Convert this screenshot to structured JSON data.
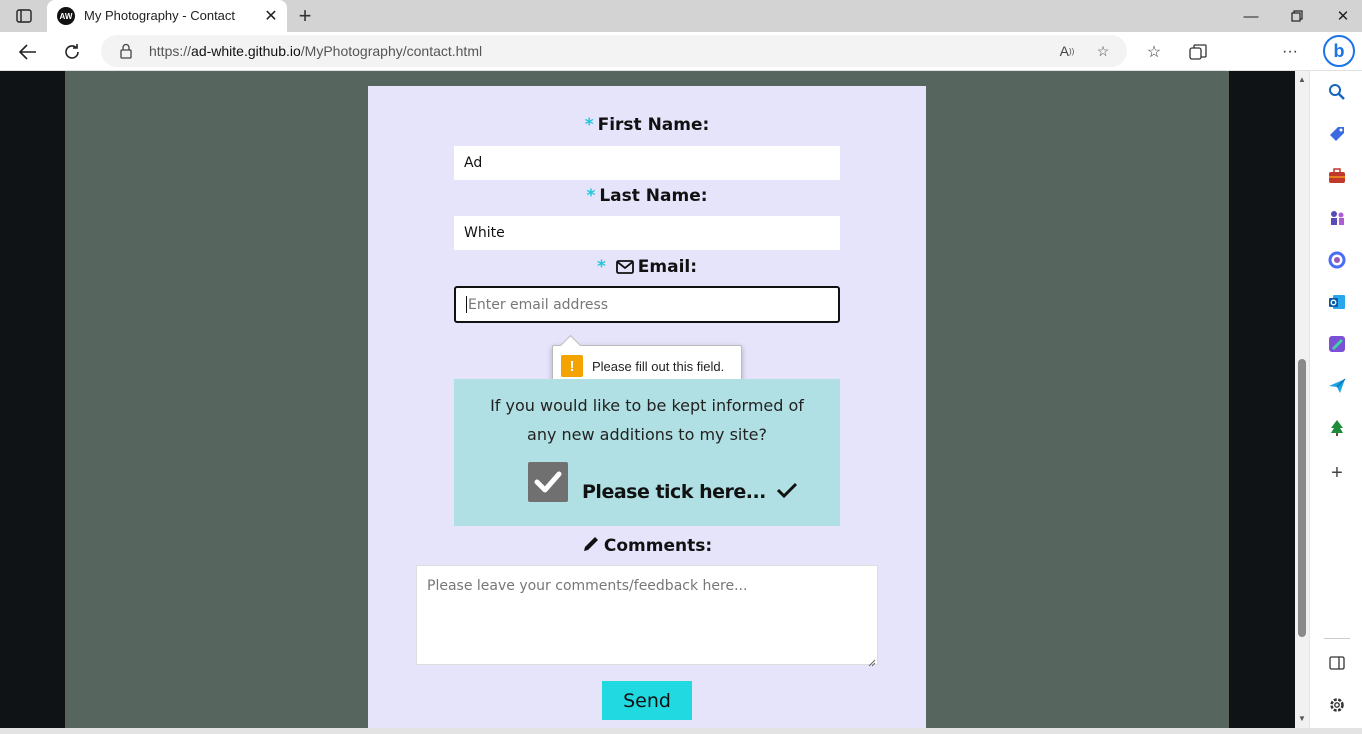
{
  "browser": {
    "tab_title": "My Photography - Contact",
    "favicon_text": "AW",
    "url_prefix": "https://",
    "url_host": "ad-white.github.io",
    "url_path": "/MyPhotography/contact.html"
  },
  "form": {
    "first_name": {
      "required_mark": "*",
      "label": "First Name:",
      "value": "Ad"
    },
    "last_name": {
      "required_mark": "*",
      "label": "Last Name:",
      "value": "White"
    },
    "email": {
      "required_mark": "*",
      "label": "Email:",
      "placeholder": "Enter email address"
    },
    "validation_tooltip": "Please fill out this field.",
    "newsletter": {
      "line1": "If you would like to be kept informed of",
      "line2": "any new additions to my site?",
      "checkbox_label": "Please tick here...",
      "checked": true
    },
    "comments": {
      "label": "Comments:",
      "placeholder": "Please leave your comments/feedback here..."
    },
    "send_label": "Send"
  },
  "colors": {
    "accent": "#20c7d8",
    "send_button": "#20d9e1",
    "card_bg": "#e6e4fb",
    "page_bg": "#56665e",
    "newsletter_bg": "#b0e0e3"
  },
  "icons": {
    "email_label": "envelope-icon",
    "comments_label": "pencil-icon",
    "tick": "checkmark-icon",
    "tooltip": "warning-icon"
  }
}
